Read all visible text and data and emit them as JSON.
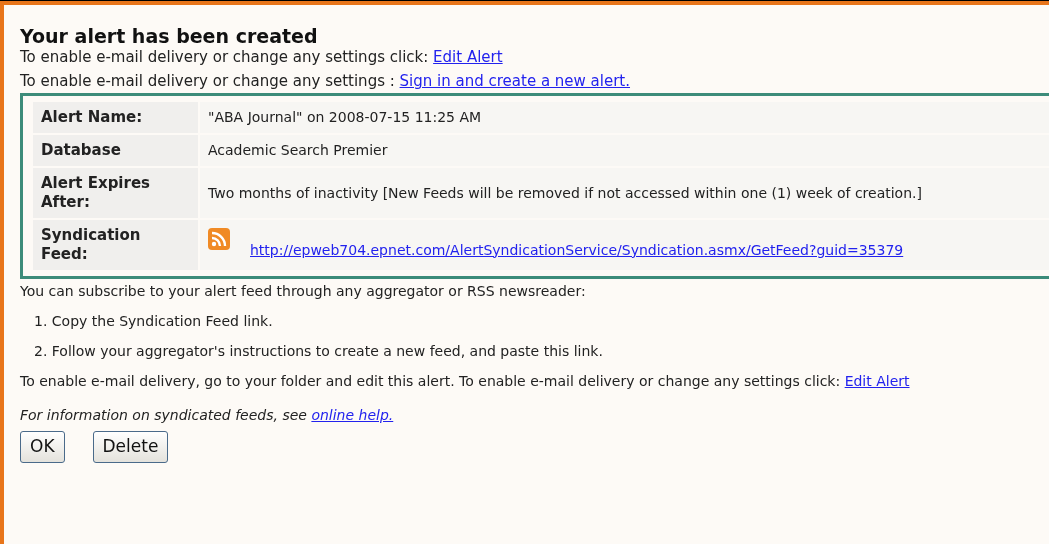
{
  "title": "Your alert has been created",
  "intro_lines": [
    {
      "text": "To enable e-mail delivery or change any settings click:",
      "link": "Edit Alert"
    },
    {
      "text": "To enable e-mail delivery or change any settings :",
      "link": "Sign in and create a new alert."
    }
  ],
  "details": [
    {
      "kind": "text",
      "label": "Alert Name:",
      "value": "\"ABA Journal\" on 2008-07-15 11:25 AM"
    },
    {
      "kind": "text",
      "label": "Database",
      "value": "Academic Search Premier"
    },
    {
      "kind": "text",
      "label": "Alert Expires After:",
      "value": "Two months of inactivity [New Feeds will be removed if not accessed within one (1) week of creation.]"
    },
    {
      "kind": "feed",
      "label": "Syndication Feed:",
      "value": "http://epweb704.epnet.com/AlertSyndicationService/Syndication.asmx/GetFeed?guid=35379"
    }
  ],
  "subscribe_text": "You can subscribe to your alert feed through any aggregator or RSS newsreader:",
  "steps": [
    "1. Copy the Syndication Feed link.",
    "2. Follow your aggregator's instructions to create a new feed, and paste this link."
  ],
  "email_line": {
    "text": "To enable e-mail delivery, go to your folder and edit this alert.  To enable e-mail delivery or change any settings click:",
    "link": "Edit Alert"
  },
  "help_line": {
    "text": "For information on syndicated feeds, see",
    "link": "online help."
  },
  "buttons": [
    "OK",
    "Delete"
  ]
}
